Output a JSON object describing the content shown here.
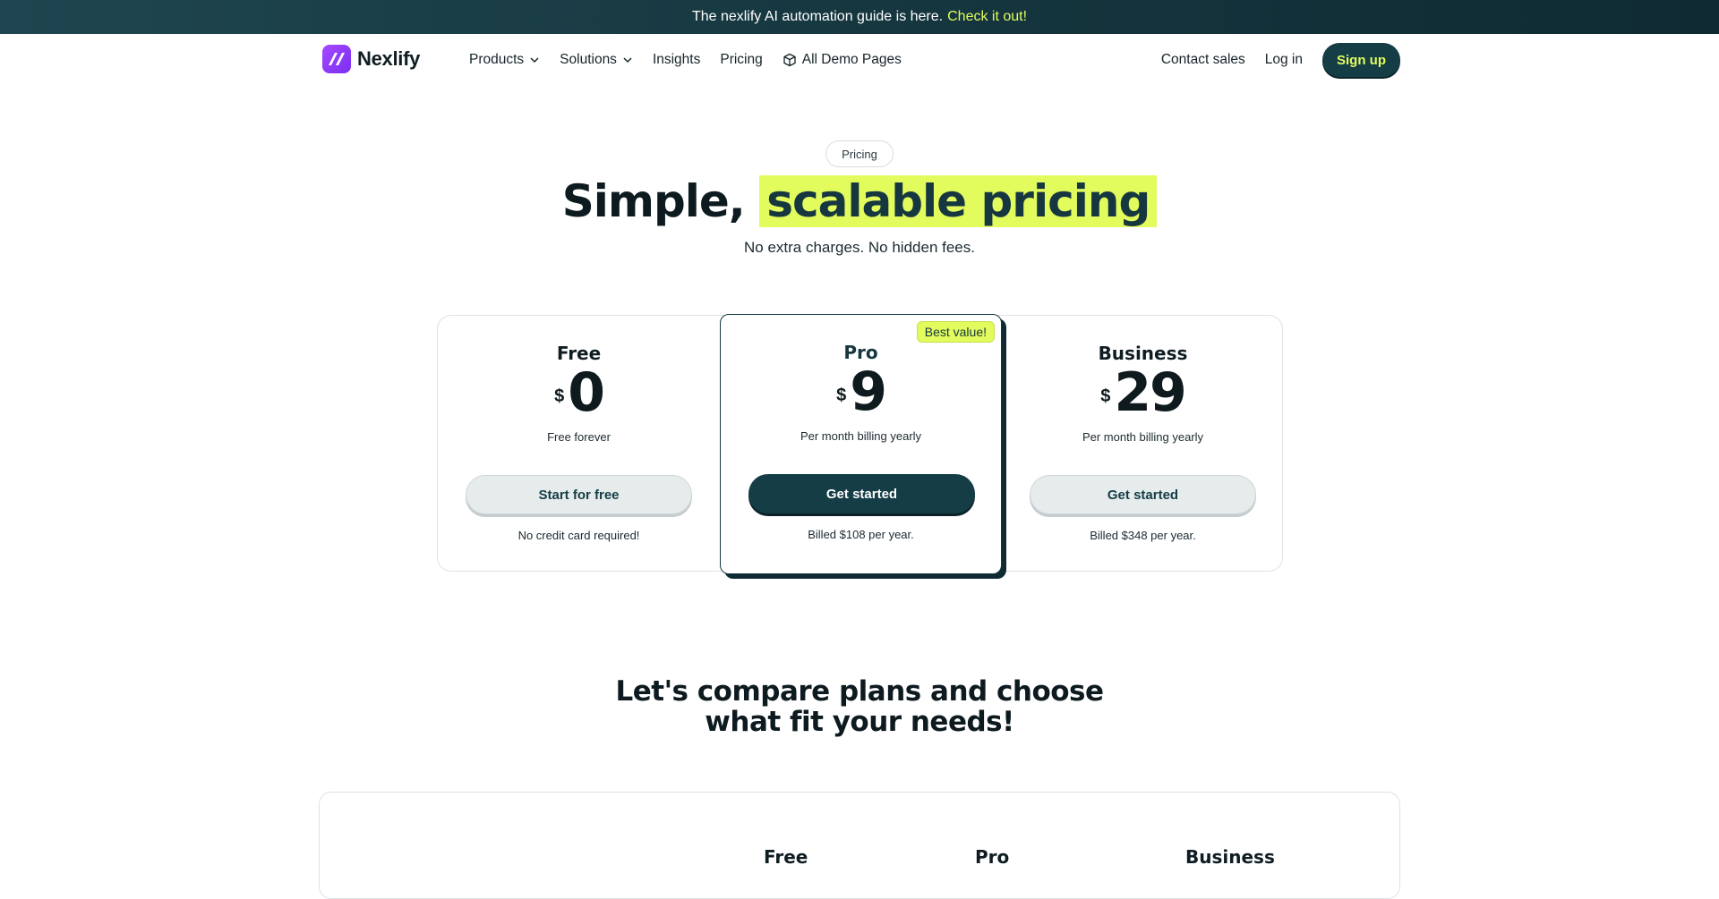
{
  "announcement": {
    "text": "The nexlify AI automation guide is here.",
    "link": "Check it out!"
  },
  "brand": {
    "name": "Nexlify"
  },
  "nav": {
    "products": "Products",
    "solutions": "Solutions",
    "insights": "Insights",
    "pricing": "Pricing",
    "demo": "All Demo Pages",
    "contact": "Contact sales",
    "login": "Log in",
    "signup": "Sign up"
  },
  "hero": {
    "pill": "Pricing",
    "title_a": "Simple,",
    "title_b": "scalable pricing",
    "subtitle": "No extra charges. No hidden fees."
  },
  "plans": [
    {
      "name": "Free",
      "currency": "$",
      "amount": "0",
      "period": "Free forever",
      "cta": "Start for free",
      "note": "No credit card required!"
    },
    {
      "name": "Pro",
      "currency": "$",
      "amount": "9",
      "period": "Per month billing yearly",
      "cta": "Get started",
      "note": "Billed $108 per year.",
      "badge": "Best value!"
    },
    {
      "name": "Business",
      "currency": "$",
      "amount": "29",
      "period": "Per month billing yearly",
      "cta": "Get started",
      "note": "Billed $348 per year."
    }
  ],
  "compare": {
    "line1": "Let's compare plans and choose",
    "line2": "what fit your needs!",
    "columns": [
      "Free",
      "Pro",
      "Business"
    ]
  },
  "colors": {
    "brand_dark": "#143d46",
    "accent_lime": "#e2fb5d",
    "logo_purple": "#8b36f7"
  },
  "icons": {
    "logo": "nexlify-logo-icon",
    "chevron": "chevron-down-icon",
    "demo": "cube-icon"
  }
}
